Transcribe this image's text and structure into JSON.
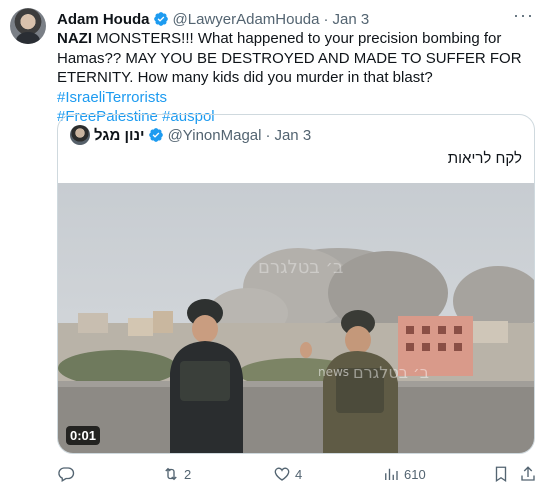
{
  "tweet": {
    "author_name": "Adam Houda",
    "handle": "@LawyerAdamHouda",
    "separator": "·",
    "date": "Jan 3",
    "text_bold": "NAZI",
    "text_body": " MONSTERS!!! What happened to your precision bombing for Hamas?? MAY YOU BE DESTROYED AND MADE TO SUFFER FOR ETERNITY. How many kids did you murder in that blast? ",
    "hashtags": [
      "#IsraeliTerrorists",
      "#FreePalestine",
      "#auspol"
    ]
  },
  "quoted": {
    "author_name": "ינון מגל",
    "handle": "@YinonMagal",
    "separator": "·",
    "date": "Jan 3",
    "text": "לקח לריאות",
    "video_duration": "0:01",
    "watermark": "ב׳ בטלגרם",
    "news_label": "news"
  },
  "actions": {
    "replies": "",
    "retweets": "2",
    "likes": "4",
    "views": "610"
  },
  "colors": {
    "link": "#1d9bf0",
    "verified": "#1d9bf0",
    "muted": "#536471"
  }
}
